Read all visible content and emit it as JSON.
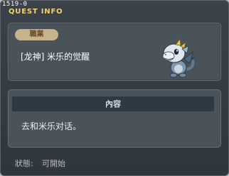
{
  "quest_id": "1519-0",
  "window_title": "QUEST INFO",
  "header": {
    "job_badge": "職業",
    "quest_name": "[龙神] 米乐的觉醒",
    "npc_icon": "baby-dragon-icon"
  },
  "content": {
    "header_label": "內容",
    "text": "去和米乐对话。"
  },
  "status": {
    "label": "狀態:",
    "value": "可開始"
  },
  "colors": {
    "title": "#f4d36b",
    "badge_bg": "#c7b38d",
    "badge_text": "#6a4c2a",
    "panel_bg": "#4b535a"
  }
}
